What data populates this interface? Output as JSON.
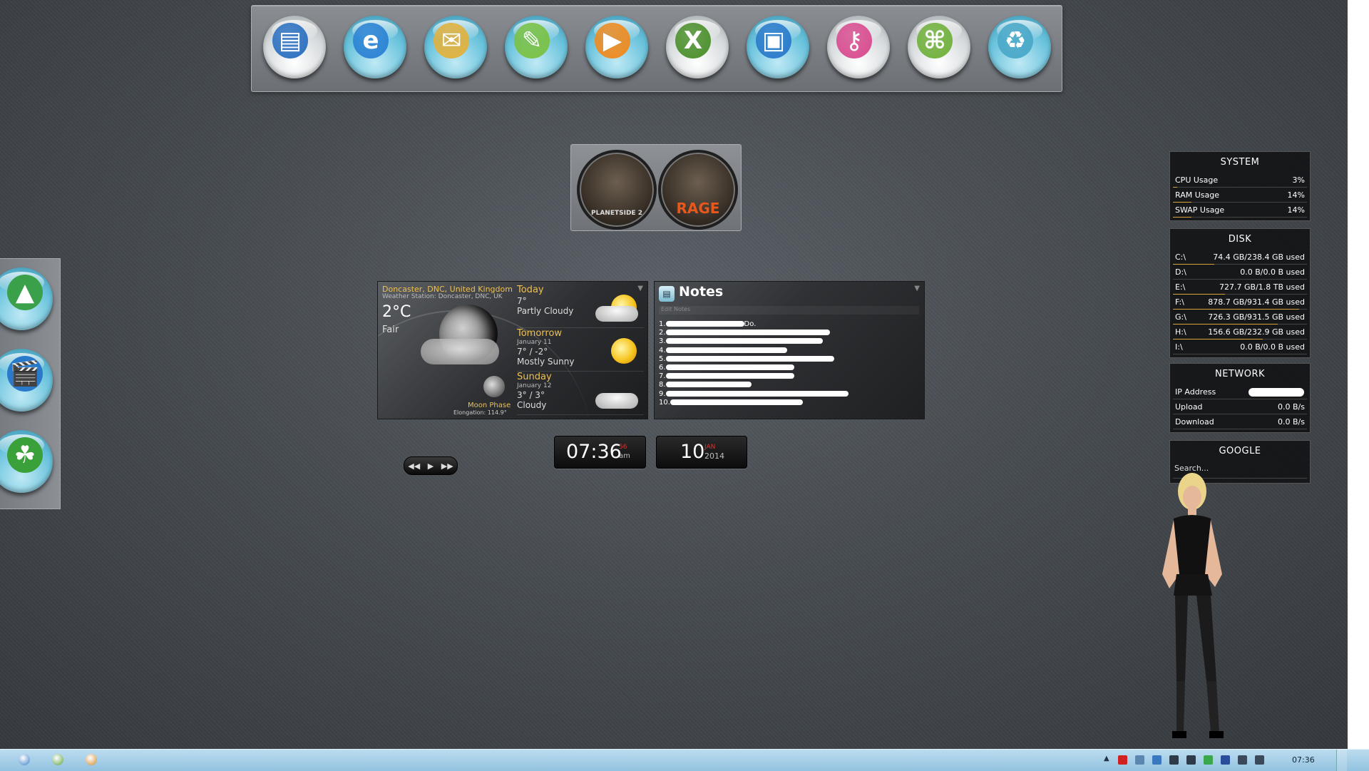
{
  "dock": {
    "items": [
      {
        "name": "computer",
        "glyph": "▤"
      },
      {
        "name": "internet-explorer",
        "glyph": "e"
      },
      {
        "name": "mail",
        "glyph": "✉"
      },
      {
        "name": "notepad",
        "glyph": "✎"
      },
      {
        "name": "media-player",
        "glyph": "▶"
      },
      {
        "name": "excel",
        "glyph": "X"
      },
      {
        "name": "save",
        "glyph": "▣"
      },
      {
        "name": "key",
        "glyph": "⚷"
      },
      {
        "name": "hardware",
        "glyph": "⌘"
      },
      {
        "name": "recycle-bin",
        "glyph": "♻"
      }
    ]
  },
  "games": {
    "items": [
      {
        "name": "planetside-2",
        "label": "PLANETSIDE 2",
        "color": "#dddddd"
      },
      {
        "name": "rage",
        "label": "RAGE",
        "color": "#e8581a"
      }
    ]
  },
  "left_dock": {
    "items": [
      {
        "name": "photos",
        "glyph": "▲"
      },
      {
        "name": "video",
        "glyph": "🎬"
      },
      {
        "name": "frog",
        "glyph": "☘"
      }
    ]
  },
  "weather": {
    "location": "Doncaster, DNC, United Kingdom",
    "station": "Weather Station: Doncaster, DNC, UK",
    "temp": "2°C",
    "condition": "Fair",
    "moon_label": "Moon Phase",
    "elongation": "Elongation: 114.9°",
    "forecast": [
      {
        "day": "Today",
        "date": "",
        "temp": "7°",
        "cond": "Partly Cloudy",
        "icon": "partly-cloudy"
      },
      {
        "day": "Tomorrow",
        "date": "January 11",
        "temp": "7° / -2°",
        "cond": "Mostly Sunny",
        "icon": "sunny"
      },
      {
        "day": "Sunday",
        "date": "January 12",
        "temp": "3° / 3°",
        "cond": "Cloudy",
        "icon": "cloudy"
      }
    ]
  },
  "notes": {
    "title": "Notes",
    "edit_label": "Edit Notes",
    "items": [
      {
        "num": "1.",
        "text": "Do.",
        "redact": 110
      },
      {
        "num": "2.",
        "text": "",
        "redact": 230
      },
      {
        "num": "3.",
        "text": "",
        "redact": 220
      },
      {
        "num": "4.",
        "text": "",
        "redact": 170
      },
      {
        "num": "5.",
        "text": "",
        "redact": 236
      },
      {
        "num": "6.",
        "text": "",
        "redact": 180
      },
      {
        "num": "7.",
        "text": "",
        "redact": 180
      },
      {
        "num": "8.",
        "text": "",
        "redact": 120
      },
      {
        "num": "9.",
        "text": "",
        "redact": 256
      },
      {
        "num": "10.",
        "text": "",
        "redact": 186
      }
    ]
  },
  "clock": {
    "time": "07:36",
    "seconds": "56",
    "ampm": "am"
  },
  "date": {
    "day": "10",
    "month": "JAN",
    "year": "2014"
  },
  "media": {
    "prev": "◀◀",
    "play": "▶",
    "next": "▶▶"
  },
  "system": {
    "title": "SYSTEM",
    "rows": [
      {
        "label": "CPU Usage",
        "value": "3%",
        "fraction": 0.03
      },
      {
        "label": "RAM Usage",
        "value": "14%",
        "fraction": 0.14
      },
      {
        "label": "SWAP Usage",
        "value": "14%",
        "fraction": 0.14
      }
    ]
  },
  "disk": {
    "title": "DISK",
    "rows": [
      {
        "label": "C:\\",
        "value": "74.4 GB/238.4 GB used",
        "fraction": 0.31
      },
      {
        "label": "D:\\",
        "value": "0.0 B/0.0 B used",
        "fraction": 0.0
      },
      {
        "label": "E:\\",
        "value": "727.7 GB/1.8 TB used",
        "fraction": 0.39
      },
      {
        "label": "F:\\",
        "value": "878.7 GB/931.4 GB used",
        "fraction": 0.94
      },
      {
        "label": "G:\\",
        "value": "726.3 GB/931.5 GB used",
        "fraction": 0.78
      },
      {
        "label": "H:\\",
        "value": "156.6 GB/232.9 GB used",
        "fraction": 0.67
      },
      {
        "label": "I:\\",
        "value": "0.0 B/0.0 B used",
        "fraction": 0.0
      }
    ]
  },
  "network": {
    "title": "NETWORK",
    "rows": [
      {
        "label": "IP Address",
        "value": ""
      },
      {
        "label": "Upload",
        "value": "0.0 B/s"
      },
      {
        "label": "Download",
        "value": "0.0 B/s"
      }
    ]
  },
  "google": {
    "title": "GOOGLE",
    "placeholder": "Search..."
  },
  "taskbar": {
    "left_icons": [
      {
        "name": "start-orb",
        "color": "#3a7ec8"
      },
      {
        "name": "green-app",
        "color": "#5aa23a"
      },
      {
        "name": "orange-app",
        "color": "#d08a2a"
      }
    ],
    "tray": [
      {
        "name": "antivirus-v",
        "color": "#d02020"
      },
      {
        "name": "water-drop",
        "color": "#5a86b0"
      },
      {
        "name": "network-globe",
        "color": "#3a78c0"
      },
      {
        "name": "flag",
        "color": "#2c3a4a"
      },
      {
        "name": "monitor",
        "color": "#2c3a4a"
      },
      {
        "name": "colored-blocks",
        "color": "#3aa84a"
      },
      {
        "name": "z-app",
        "color": "#2a4e9a"
      },
      {
        "name": "display",
        "color": "#3a4a5a"
      },
      {
        "name": "volume",
        "color": "#3a4a5a"
      }
    ],
    "caret": "▲",
    "time": "07:36"
  }
}
